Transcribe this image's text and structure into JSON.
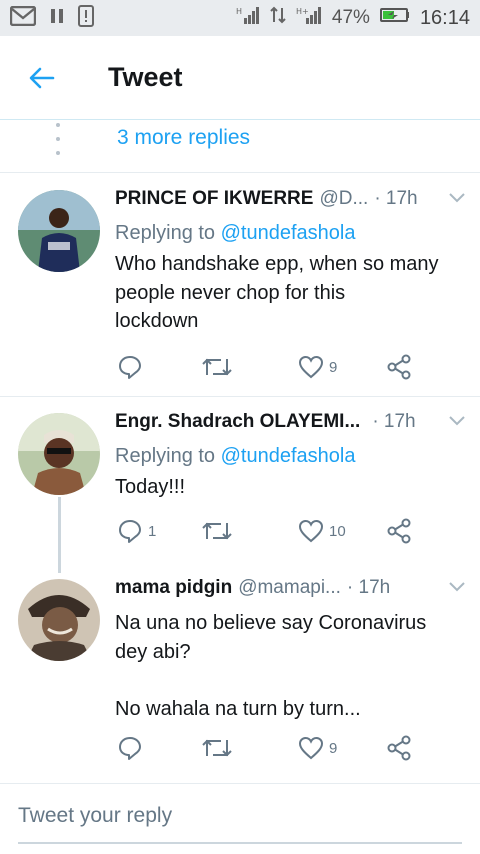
{
  "status_bar": {
    "battery": "47%",
    "time": "16:14"
  },
  "header": {
    "title": "Tweet"
  },
  "more_replies": {
    "label": "3 more replies"
  },
  "tweets": [
    {
      "name": "PRINCE OF IKWERRE",
      "handle": "@D...",
      "time": "· 17h",
      "replying_prefix": "Replying to ",
      "replying_to": "@tundefashola",
      "text": "Who handshake epp, when so many\npeople never chop for this\nlockdown",
      "reply_count": "",
      "retweet_count": "",
      "like_count": "9"
    },
    {
      "name": "Engr. Shadrach OLAYEMI...",
      "handle": "",
      "time": "· 17h",
      "replying_prefix": "Replying to ",
      "replying_to": "@tundefashola",
      "text": "Today!!!",
      "reply_count": "1",
      "retweet_count": "",
      "like_count": "10"
    },
    {
      "name": "mama pidgin",
      "handle": "@mamapi...",
      "time": "· 17h",
      "replying_prefix": "",
      "replying_to": "",
      "text": "Na una no believe say Coronavirus\ndey abi?\n\nNo wahala na turn by turn...",
      "reply_count": "",
      "retweet_count": "",
      "like_count": "9"
    }
  ],
  "composer": {
    "placeholder": "Tweet your reply"
  },
  "colors": {
    "accent": "#1da1f2",
    "secondary_text": "#657786",
    "primary_text": "#14171a"
  }
}
